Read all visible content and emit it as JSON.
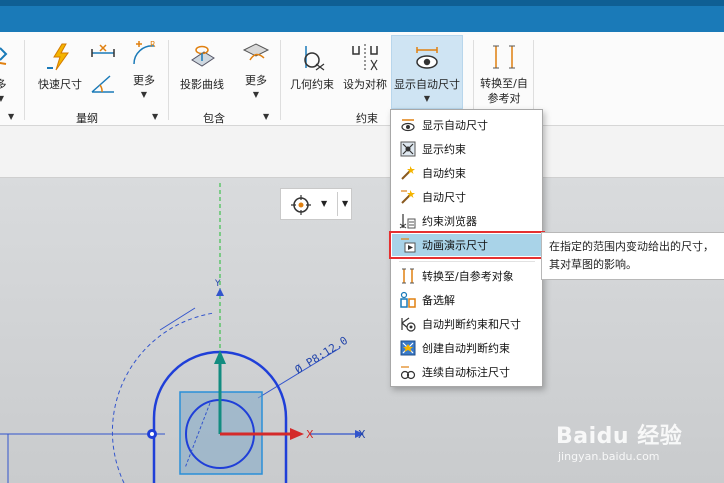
{
  "ribbon": {
    "tools": {
      "partial_more_left": "多",
      "quick_dim": "快速尺寸",
      "more1": "更多",
      "project_curve": "投影曲线",
      "more2": "更多",
      "geom_constraint": "几何约束",
      "make_symmetric": "设为对称",
      "show_auto_dim": "显示自动尺寸",
      "convert_ref": "转换至/自参考对"
    },
    "groups": {
      "dimensions": "量纲",
      "include": "包含",
      "constraints": "约束"
    }
  },
  "menu": {
    "items": [
      {
        "label": "显示自动尺寸",
        "icon": "show-auto-dim-icon"
      },
      {
        "label": "显示约束",
        "icon": "show-constraints-icon"
      },
      {
        "label": "自动约束",
        "icon": "auto-constrain-icon"
      },
      {
        "label": "自动尺寸",
        "icon": "auto-dimension-icon"
      },
      {
        "label": "约束浏览器",
        "icon": "constraint-browser-icon"
      },
      {
        "label": "动画演示尺寸",
        "icon": "animate-dimension-icon"
      },
      {
        "label": "转换至/自参考对象",
        "icon": "convert-reference-icon"
      },
      {
        "label": "备选解",
        "icon": "alternate-solution-icon"
      },
      {
        "label": "自动判断约束和尺寸",
        "icon": "infer-constraints-icon"
      },
      {
        "label": "创建自动判断约束",
        "icon": "create-inferred-icon"
      },
      {
        "label": "连续自动标注尺寸",
        "icon": "continuous-auto-dim-icon"
      }
    ]
  },
  "tooltip": {
    "line1": "在指定的范围内变动给出的尺寸，",
    "line2": "其对草图的影响。"
  },
  "canvas": {
    "dim_label": "Ø P8:12.0",
    "x_axis": "X",
    "y_axis": "Y"
  },
  "watermark": {
    "brand": "Baidu 经验",
    "url": "jingyan.baidu.com"
  },
  "colors": {
    "accent_blue": "#1a7ab8",
    "highlight": "#a9d3e8",
    "highlight_border": "#e53030",
    "sketch_blue": "#1f3fd8"
  }
}
